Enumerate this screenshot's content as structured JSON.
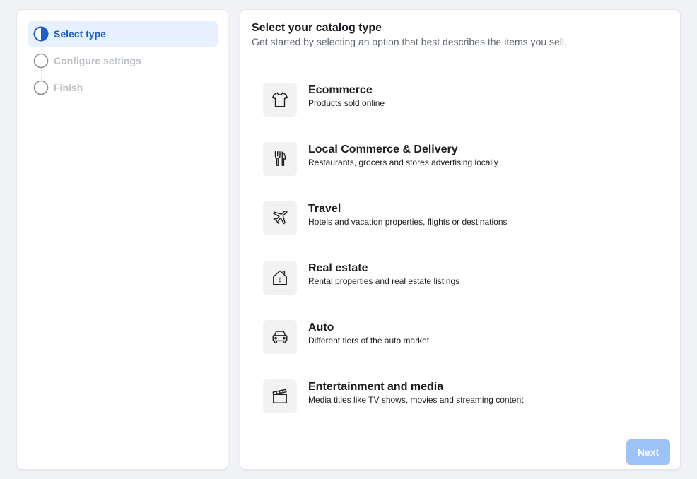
{
  "steps": [
    {
      "label": "Select type"
    },
    {
      "label": "Configure settings"
    },
    {
      "label": "Finish"
    }
  ],
  "main": {
    "title": "Select your catalog type",
    "subtitle": "Get started by selecting an option that best describes the items you sell."
  },
  "options": [
    {
      "name": "Ecommerce",
      "desc": "Products sold online",
      "icon": "tshirt-icon"
    },
    {
      "name": "Local Commerce & Delivery",
      "desc": "Restaurants, grocers and stores advertising locally",
      "icon": "fork-knife-icon"
    },
    {
      "name": "Travel",
      "desc": "Hotels and vacation properties, flights or destinations",
      "icon": "airplane-icon"
    },
    {
      "name": "Real estate",
      "desc": "Rental properties and real estate listings",
      "icon": "house-dollar-icon"
    },
    {
      "name": "Auto",
      "desc": "Different tiers of the auto market",
      "icon": "car-icon"
    },
    {
      "name": "Entertainment and media",
      "desc": "Media titles like TV shows, movies and streaming content",
      "icon": "clapperboard-icon"
    }
  ],
  "footer": {
    "next_label": "Next"
  },
  "colors": {
    "accent": "#1a5fc7",
    "active_bg": "#e7f0fd",
    "disabled_button": "#9cc2f7"
  }
}
